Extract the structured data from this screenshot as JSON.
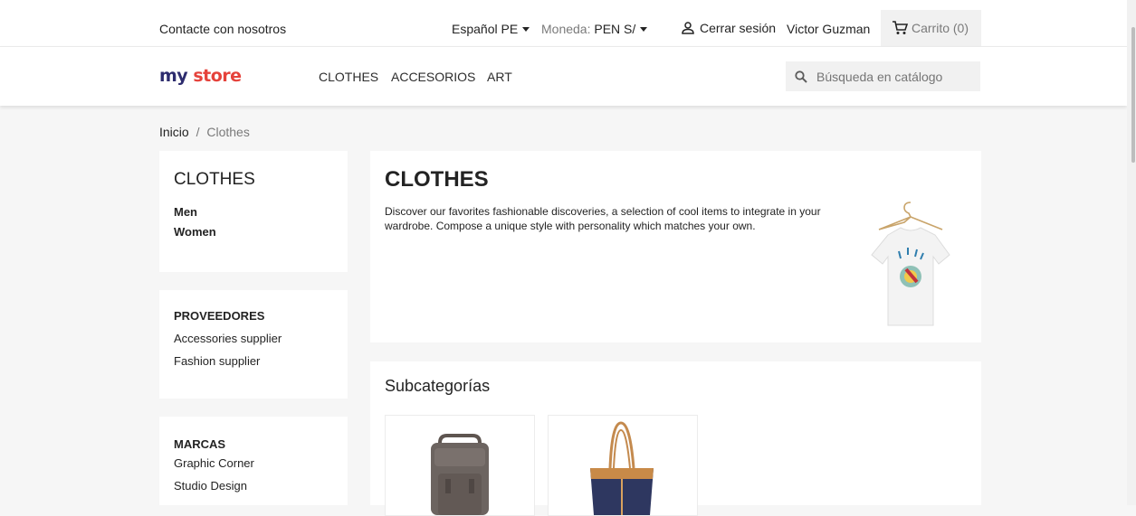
{
  "topbar": {
    "contact": "Contacte con nosotros",
    "language": "Español PE",
    "currency_label": "Moneda:",
    "currency_value": "PEN S/",
    "logout": "Cerrar sesión",
    "user_name": "Victor Guzman",
    "cart": "Carrito (0)"
  },
  "header": {
    "logo_part1": "my ",
    "logo_part2": "store",
    "nav": [
      "CLOTHES",
      "ACCESORIOS",
      "ART"
    ],
    "search_placeholder": "Búsqueda en catálogo"
  },
  "breadcrumb": {
    "home": "Inicio",
    "separator": "/",
    "current": "Clothes"
  },
  "sidebar": {
    "category_title": "CLOTHES",
    "subcategories": [
      "Men",
      "Women"
    ],
    "suppliers_title": "PROVEEDORES",
    "suppliers": [
      "Accessories supplier",
      "Fashion supplier"
    ],
    "brands_title": "MARCAS",
    "brands": [
      "Graphic Corner",
      "Studio Design"
    ]
  },
  "category": {
    "title": "CLOTHES",
    "description": "Discover our favorites fashionable discoveries, a selection of cool items to integrate in your wardrobe. Compose a unique style with personality which matches your own."
  },
  "subcategories_section": {
    "title": "Subcategorías"
  },
  "colors": {
    "logo_blue": "#2d2c6e",
    "logo_red": "#e5423b",
    "background": "#f6f6f6"
  }
}
